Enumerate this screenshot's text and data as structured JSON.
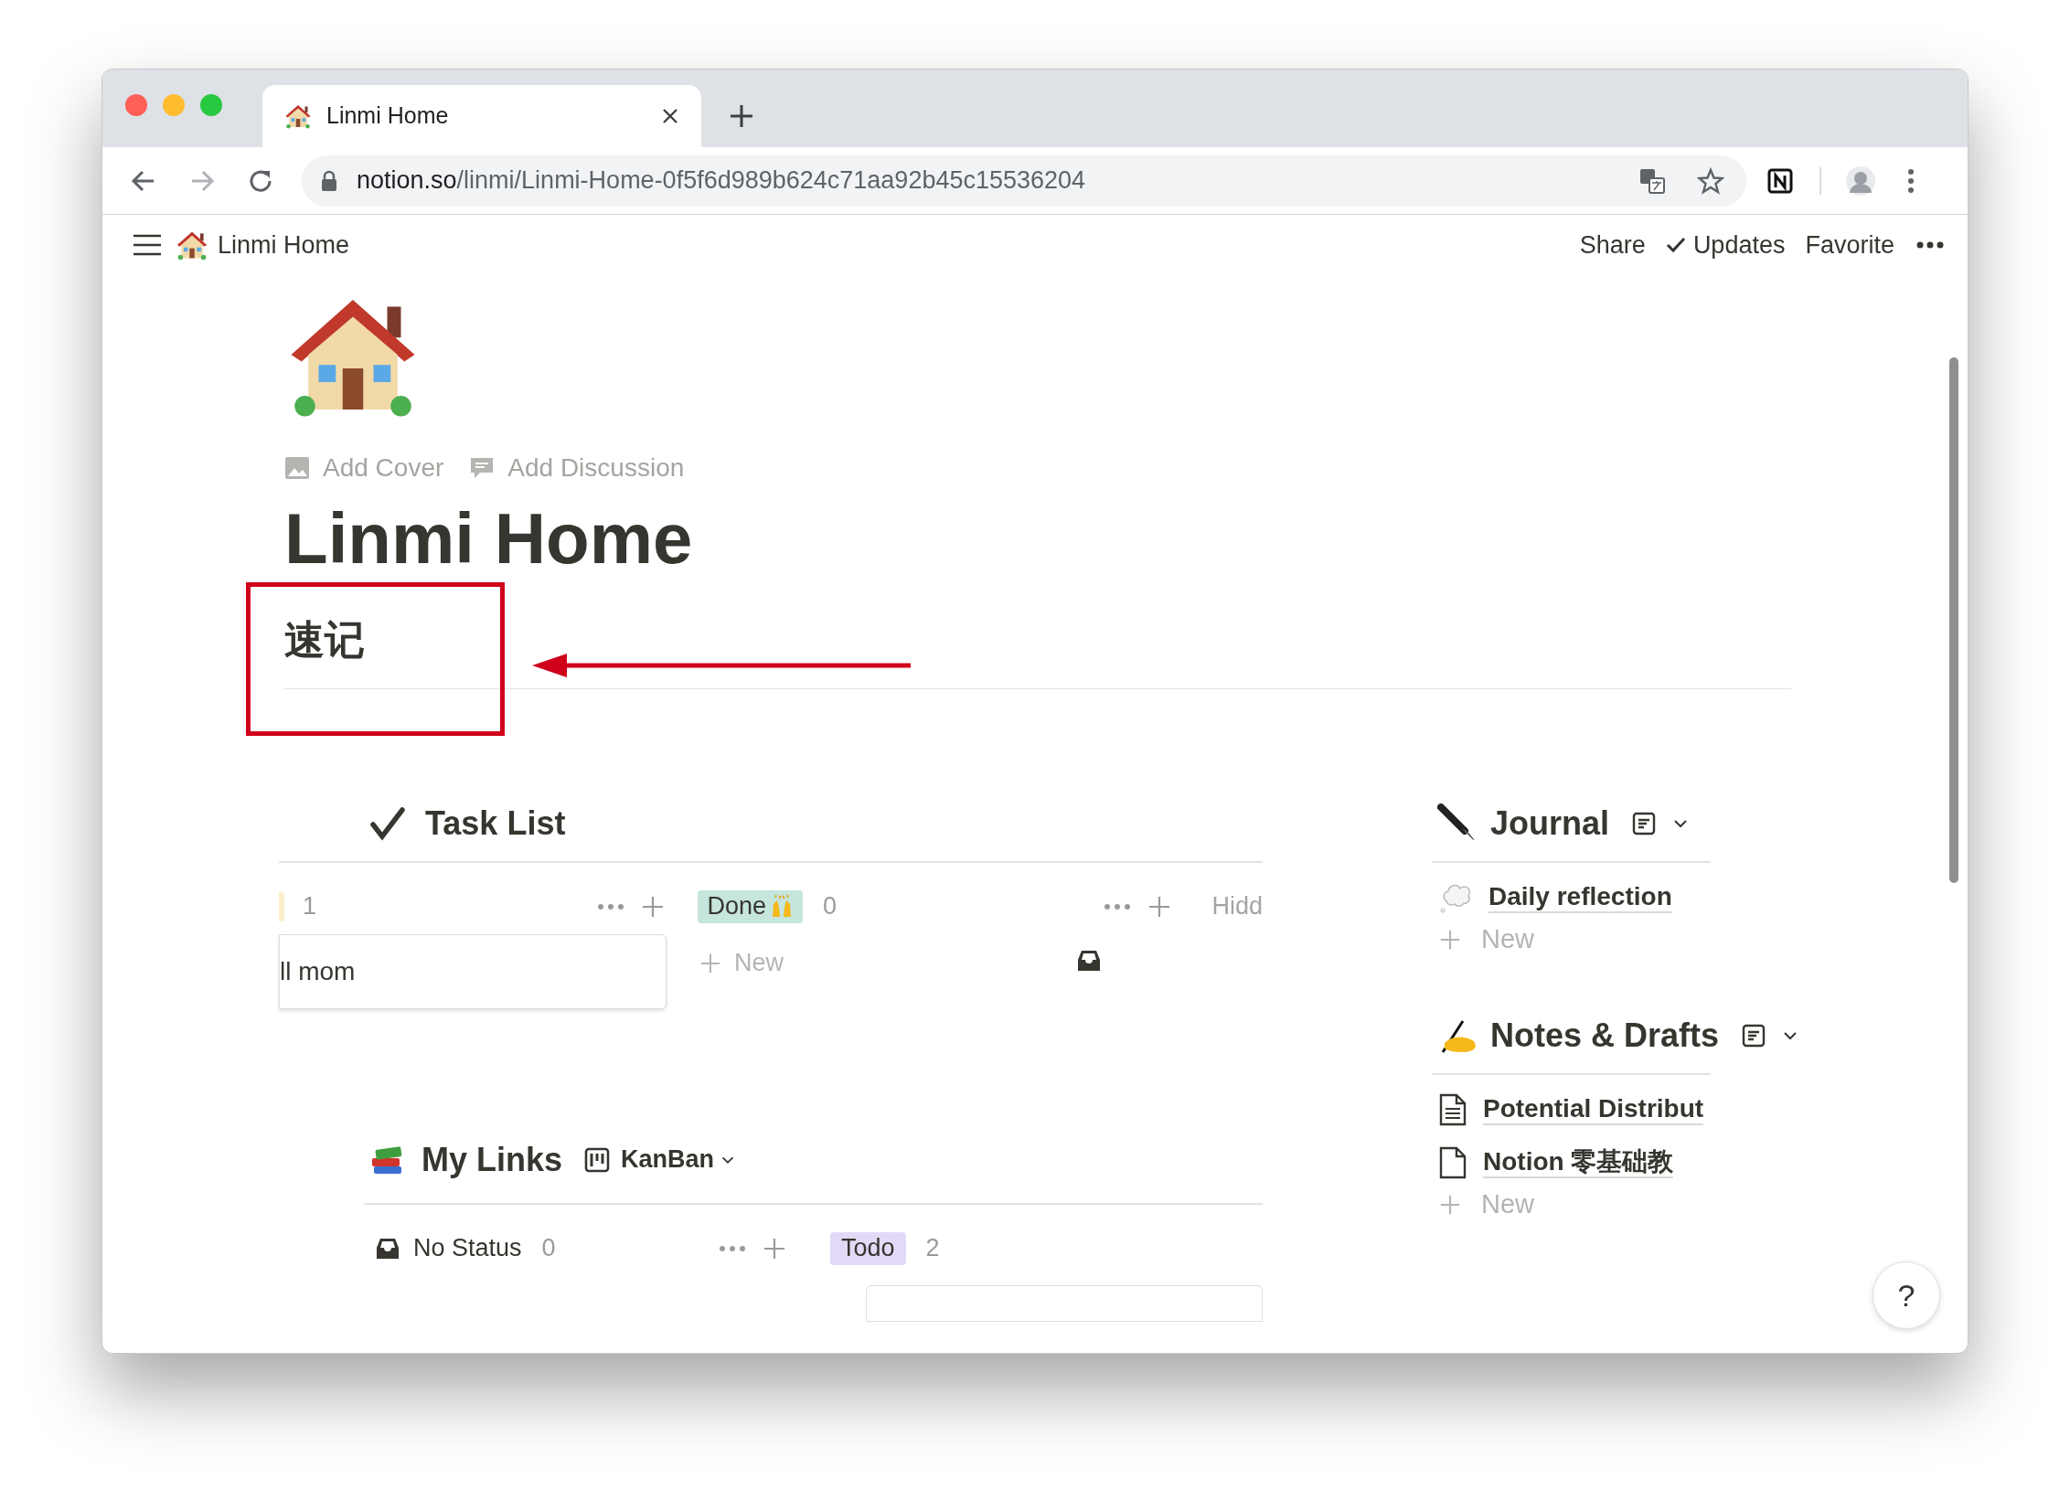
{
  "browser": {
    "tab": {
      "title": "Linmi Home"
    },
    "address": {
      "domain": "notion.so",
      "path": "/linmi/Linmi-Home-0f5f6d989b624c71aa92b45c15536204"
    }
  },
  "topbar": {
    "breadcrumb": "Linmi Home",
    "actions": [
      "Share",
      "Updates",
      "Favorite"
    ]
  },
  "page": {
    "actions": [
      "Add Cover",
      "Add Discussion"
    ],
    "title": "Linmi Home",
    "heading": "速记"
  },
  "task_list": {
    "title": "Task List",
    "groups": [
      {
        "count": "1",
        "color": "#fbeecb"
      },
      {
        "label": "Done",
        "count": "0",
        "color": "#c5e5dd"
      }
    ],
    "hidden_label": "Hidd",
    "card": "ll mom",
    "new_label": "New"
  },
  "my_links": {
    "title": "My Links",
    "view": "KanBan",
    "groups": [
      {
        "kind": "plain",
        "label": "No Status",
        "count": "0"
      },
      {
        "kind": "tag",
        "label": "Todo",
        "count": "2",
        "color": "#e3d9f7"
      }
    ]
  },
  "journal": {
    "title": "Journal",
    "items": [
      {
        "title": "Daily reflection",
        "kind": "cloud"
      }
    ],
    "new_label": "New"
  },
  "notes": {
    "title": "Notes & Drafts",
    "items": [
      {
        "title": "Potential Distribut",
        "kind": "text"
      },
      {
        "title": "Notion 零基础教",
        "kind": "blank"
      }
    ],
    "new_label": "New"
  },
  "help": "?"
}
